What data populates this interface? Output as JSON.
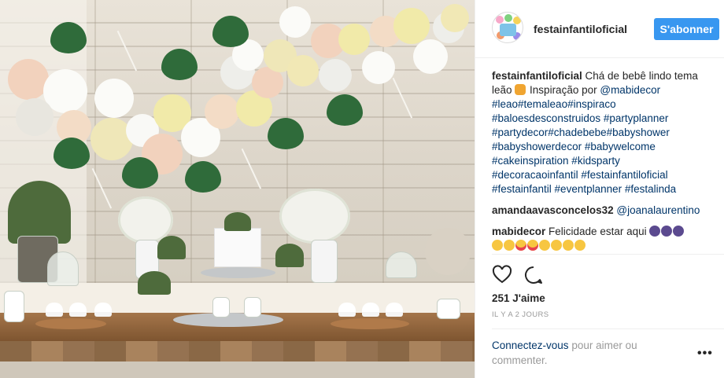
{
  "post_image": {
    "alt": ""
  },
  "header": {
    "avatar_icon": "festa-infantil-avatar-icon",
    "username": "festainfantiloficial",
    "follow_label": "S'abonner",
    "accent_color": "#3897f0"
  },
  "caption": {
    "user": "festainfantiloficial",
    "text_before": " Chá de bebê lindo tema leão",
    "emoji_lion": "lion-face-emoji",
    "text_after": " Inspiração por ",
    "mention": "@mabidecor",
    "hashtags_line1": "#leao#temaleao#inspiraco",
    "hashtags_line2": "#baloesdesconstruidos #partyplanner",
    "hashtags_line3": "#partydecor#chadebebe#babyshower",
    "hashtags_line4": "#babyshowerdecor #babywelcome",
    "hashtags_line5": "#cakeinspiration #kidsparty",
    "hashtags_line6": "#decoracaoinfantil #festainfantiloficial",
    "hashtags_line7": "#festainfantil #eventplanner #festalinda"
  },
  "comments": [
    {
      "user": "amandaavasconcelos32",
      "mention": "@joanalaurentino"
    },
    {
      "user": "mabidecor",
      "text": " Felicidade estar aqui "
    }
  ],
  "actions": {
    "like_icon": "heart-icon",
    "comment_icon": "comment-bubble-icon"
  },
  "likes_label": "251 J'aime",
  "timestamp": "IL Y A 2 JOURS",
  "login_prompt": {
    "link": "Connectez-vous",
    "rest": " pour aimer ou commenter."
  },
  "more_icon": "ellipsis-icon",
  "more_label": "•••"
}
